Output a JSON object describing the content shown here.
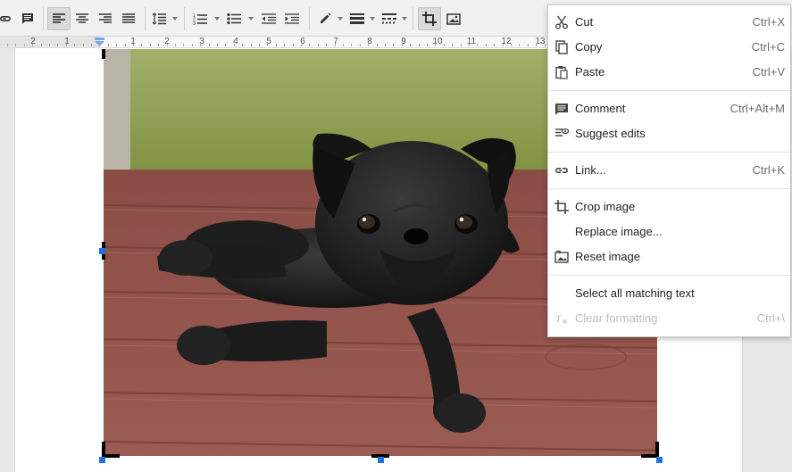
{
  "toolbar": {
    "buttons": [
      {
        "name": "insert-link",
        "icon": "link-icon"
      },
      {
        "name": "insert-comment",
        "icon": "comment-icon"
      },
      {
        "name": "align-left",
        "icon": "align-left-icon",
        "active": true
      },
      {
        "name": "align-center",
        "icon": "align-center-icon"
      },
      {
        "name": "align-right",
        "icon": "align-right-icon"
      },
      {
        "name": "align-justify",
        "icon": "align-justify-icon"
      },
      {
        "name": "line-spacing",
        "icon": "line-spacing-icon"
      },
      {
        "name": "numbered-list",
        "icon": "numbered-list-icon"
      },
      {
        "name": "bulleted-list",
        "icon": "bulleted-list-icon"
      },
      {
        "name": "decrease-indent",
        "icon": "decrease-indent-icon"
      },
      {
        "name": "increase-indent",
        "icon": "increase-indent-icon"
      },
      {
        "name": "border-color",
        "icon": "pencil-icon"
      },
      {
        "name": "border-weight",
        "icon": "border-weight-icon"
      },
      {
        "name": "border-dash",
        "icon": "border-dash-icon"
      },
      {
        "name": "crop-image",
        "icon": "crop-icon",
        "active": true
      },
      {
        "name": "image-options",
        "icon": "image-options-icon"
      }
    ]
  },
  "ruler": {
    "numbers": [
      "2",
      "1",
      "1",
      "2",
      "3",
      "4",
      "5",
      "6",
      "7",
      "8",
      "9",
      "10",
      "11",
      "12",
      "13"
    ]
  },
  "document": {
    "image": {
      "subject_icon": "pug-photo"
    }
  },
  "context_menu": {
    "groups": [
      [
        {
          "label": "Cut",
          "shortcut": "Ctrl+X",
          "icon": "scissors-icon"
        },
        {
          "label": "Copy",
          "shortcut": "Ctrl+C",
          "icon": "copy-icon"
        },
        {
          "label": "Paste",
          "shortcut": "Ctrl+V",
          "icon": "paste-icon"
        }
      ],
      [
        {
          "label": "Comment",
          "shortcut": "Ctrl+Alt+M",
          "icon": "comment-icon"
        },
        {
          "label": "Suggest edits",
          "shortcut": "",
          "icon": "suggest-edits-icon"
        }
      ],
      [
        {
          "label": "Link...",
          "shortcut": "Ctrl+K",
          "icon": "link-icon"
        }
      ],
      [
        {
          "label": "Crop image",
          "shortcut": "",
          "icon": "crop-icon"
        },
        {
          "label": "Replace image...",
          "shortcut": "",
          "icon": ""
        },
        {
          "label": "Reset image",
          "shortcut": "",
          "icon": "reset-image-icon"
        }
      ],
      [
        {
          "label": "Select all matching text",
          "shortcut": "",
          "icon": ""
        },
        {
          "label": "Clear formatting",
          "shortcut": "Ctrl+\\",
          "icon": "clear-formatting-icon",
          "disabled": true
        }
      ]
    ]
  },
  "colors": {
    "accent": "#1a73e8",
    "menu_text": "#222222",
    "menu_shortcut": "#6b6b6b",
    "disabled_text": "#bdbdbd"
  }
}
